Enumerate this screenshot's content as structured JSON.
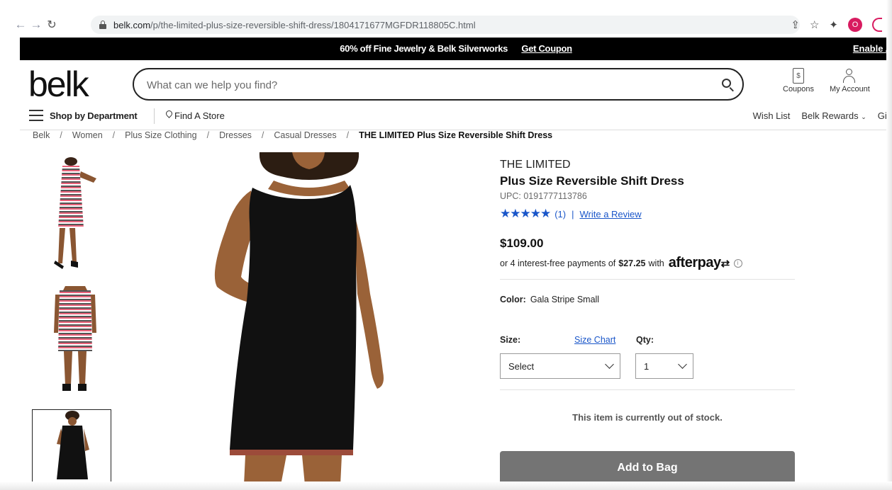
{
  "browser": {
    "url_host": "belk.com",
    "url_path": "/p/the-limited-plus-size-reversible-shift-dress/1804171677MGFDR118805C.html",
    "profile_initial": "O"
  },
  "promo": {
    "text": "60% off Fine Jewelry & Belk Silverworks",
    "coupon_link": "Get Coupon",
    "right_link": "Enable A"
  },
  "header": {
    "logo": "belk",
    "search_placeholder": "What can we help you find?",
    "coupons_label": "Coupons",
    "account_label": "My Account"
  },
  "dept_nav": {
    "shop_by_department": "Shop by Department",
    "find_store": "Find A Store",
    "wish_list": "Wish List",
    "rewards": "Belk Rewards",
    "gift": "Gift"
  },
  "breadcrumb": [
    "Belk",
    "Women",
    "Plus Size Clothing",
    "Dresses",
    "Casual Dresses",
    "THE LIMITED Plus Size Reversible Shift Dress"
  ],
  "product": {
    "brand": "THE LIMITED",
    "name": "Plus Size Reversible Shift Dress",
    "upc": "UPC: 0191777113786",
    "stars": "★★★★★",
    "rating_count": "(1)",
    "write_review": "Write a Review",
    "price": "$109.00",
    "afterpay_prefix": "or 4 interest-free payments of",
    "afterpay_amount": "$27.25",
    "afterpay_with": "with",
    "afterpay_brand": "afterpay",
    "color_label": "Color:",
    "color_value": "Gala Stripe Small",
    "size_label": "Size:",
    "size_chart": "Size Chart",
    "qty_label": "Qty:",
    "size_value": "Select",
    "qty_value": "1",
    "stock_message": "This item is currently out of stock.",
    "add_to_bag": "Add to Bag"
  },
  "colors": {
    "star_blue": "#1a56c9",
    "add_bag_gray": "#747474",
    "promo_black": "#000000"
  }
}
